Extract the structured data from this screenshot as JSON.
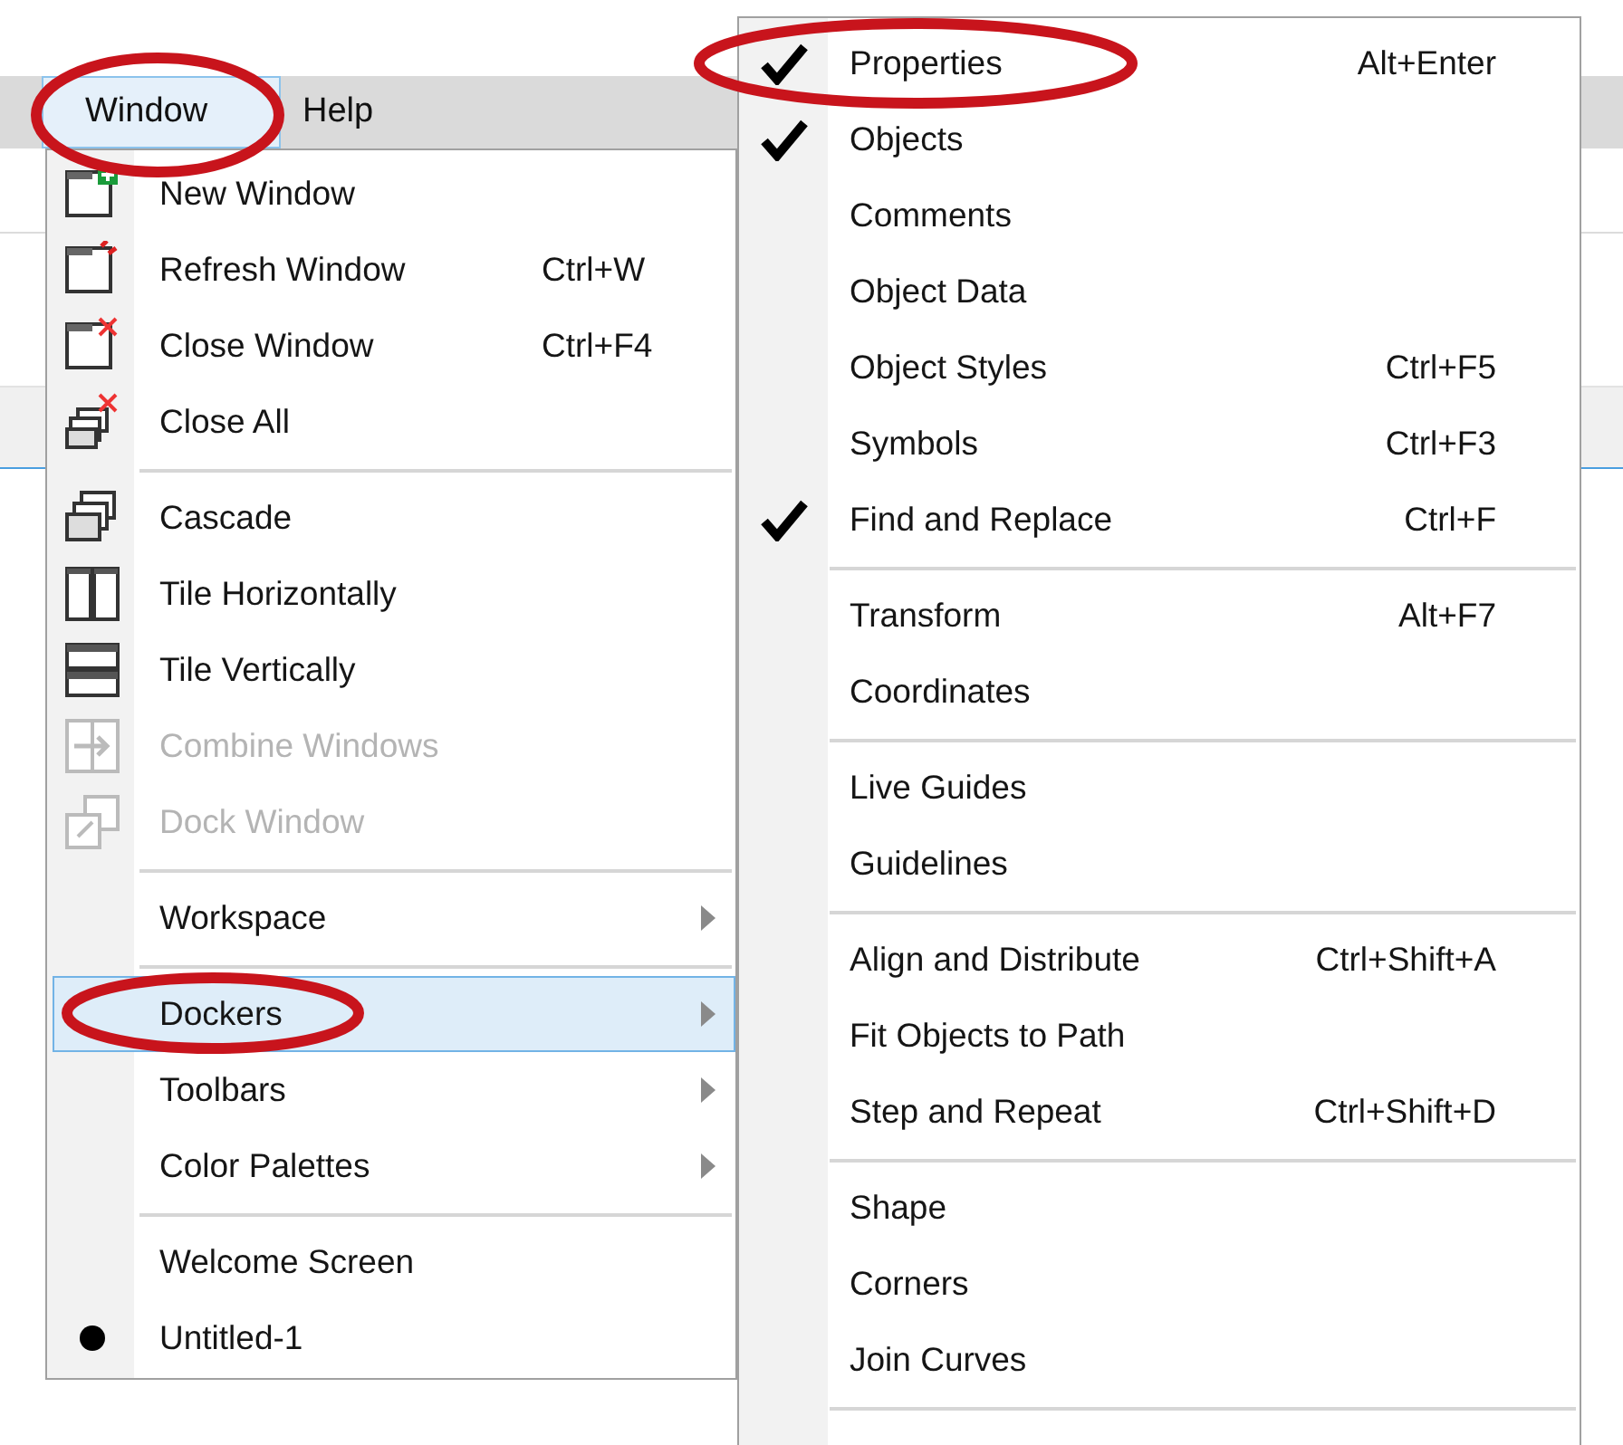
{
  "menu_bar": {
    "items": [
      {
        "label": "Window",
        "selected": true,
        "circled": true
      },
      {
        "label": "Help",
        "selected": false,
        "circled": false
      }
    ]
  },
  "window_menu": {
    "groups": [
      {
        "items": [
          {
            "label": "New Window",
            "disabled": false,
            "selected": false,
            "checked": false,
            "submenu": false,
            "circled": false
          },
          {
            "label": "Refresh Window",
            "shortcut": "Ctrl+W",
            "disabled": false,
            "selected": false,
            "checked": false,
            "submenu": false,
            "circled": false
          },
          {
            "label": "Close Window",
            "shortcut": "Ctrl+F4",
            "disabled": false,
            "selected": false,
            "checked": false,
            "submenu": false,
            "circled": false
          },
          {
            "label": "Close All",
            "disabled": false,
            "selected": false,
            "checked": false,
            "submenu": false,
            "circled": false
          }
        ]
      },
      {
        "items": [
          {
            "label": "Cascade",
            "disabled": false,
            "selected": false,
            "checked": false,
            "submenu": false,
            "circled": false
          },
          {
            "label": "Tile Horizontally",
            "disabled": false,
            "selected": false,
            "checked": false,
            "submenu": false,
            "circled": false
          },
          {
            "label": "Tile Vertically",
            "disabled": false,
            "selected": false,
            "checked": false,
            "submenu": false,
            "circled": false
          },
          {
            "label": "Combine Windows",
            "disabled": true,
            "selected": false,
            "checked": false,
            "submenu": false,
            "circled": false
          },
          {
            "label": "Dock Window",
            "disabled": true,
            "selected": false,
            "checked": false,
            "submenu": false,
            "circled": false
          }
        ]
      },
      {
        "items": [
          {
            "label": "Workspace",
            "disabled": false,
            "selected": false,
            "checked": false,
            "submenu": true,
            "circled": false
          }
        ]
      },
      {
        "items": [
          {
            "label": "Dockers",
            "disabled": false,
            "selected": true,
            "checked": false,
            "submenu": true,
            "circled": true
          },
          {
            "label": "Toolbars",
            "disabled": false,
            "selected": false,
            "checked": false,
            "submenu": true,
            "circled": false
          },
          {
            "label": "Color Palettes",
            "disabled": false,
            "selected": false,
            "checked": false,
            "submenu": true,
            "circled": false
          }
        ]
      },
      {
        "items": [
          {
            "label": "Welcome Screen",
            "disabled": false,
            "selected": false,
            "checked": false,
            "submenu": false,
            "circled": false
          },
          {
            "label": "Untitled-1",
            "disabled": false,
            "selected": false,
            "checked": true,
            "submenu": false,
            "circled": false
          }
        ]
      }
    ]
  },
  "dockers_submenu": {
    "cut_off": true,
    "groups": [
      {
        "items": [
          {
            "label": "Properties",
            "shortcut": "Alt+Enter",
            "checked": true,
            "circled": true
          },
          {
            "label": "Objects",
            "checked": true,
            "circled": false
          },
          {
            "label": "Comments",
            "checked": false,
            "circled": false
          },
          {
            "label": "Object Data",
            "checked": false,
            "circled": false
          },
          {
            "label": "Object Styles",
            "shortcut": "Ctrl+F5",
            "checked": false,
            "circled": false
          },
          {
            "label": "Symbols",
            "shortcut": "Ctrl+F3",
            "checked": false,
            "circled": false
          },
          {
            "label": "Find and Replace",
            "shortcut": "Ctrl+F",
            "checked": true,
            "circled": false
          }
        ]
      },
      {
        "items": [
          {
            "label": "Transform",
            "shortcut": "Alt+F7",
            "checked": false,
            "circled": false
          },
          {
            "label": "Coordinates",
            "checked": false,
            "circled": false
          }
        ]
      },
      {
        "items": [
          {
            "label": "Live Guides",
            "checked": false,
            "circled": false
          },
          {
            "label": "Guidelines",
            "checked": false,
            "circled": false
          }
        ]
      },
      {
        "items": [
          {
            "label": "Align and Distribute",
            "shortcut": "Ctrl+Shift+A",
            "checked": false,
            "circled": false
          },
          {
            "label": "Fit Objects to Path",
            "checked": false,
            "circled": false
          },
          {
            "label": "Step and Repeat",
            "shortcut": "Ctrl+Shift+D",
            "checked": false,
            "circled": false
          }
        ]
      },
      {
        "items": [
          {
            "label": "Shape",
            "checked": false,
            "circled": false
          },
          {
            "label": "Corners",
            "checked": false,
            "circled": false
          },
          {
            "label": "Join Curves",
            "checked": false,
            "circled": false
          }
        ]
      }
    ]
  }
}
